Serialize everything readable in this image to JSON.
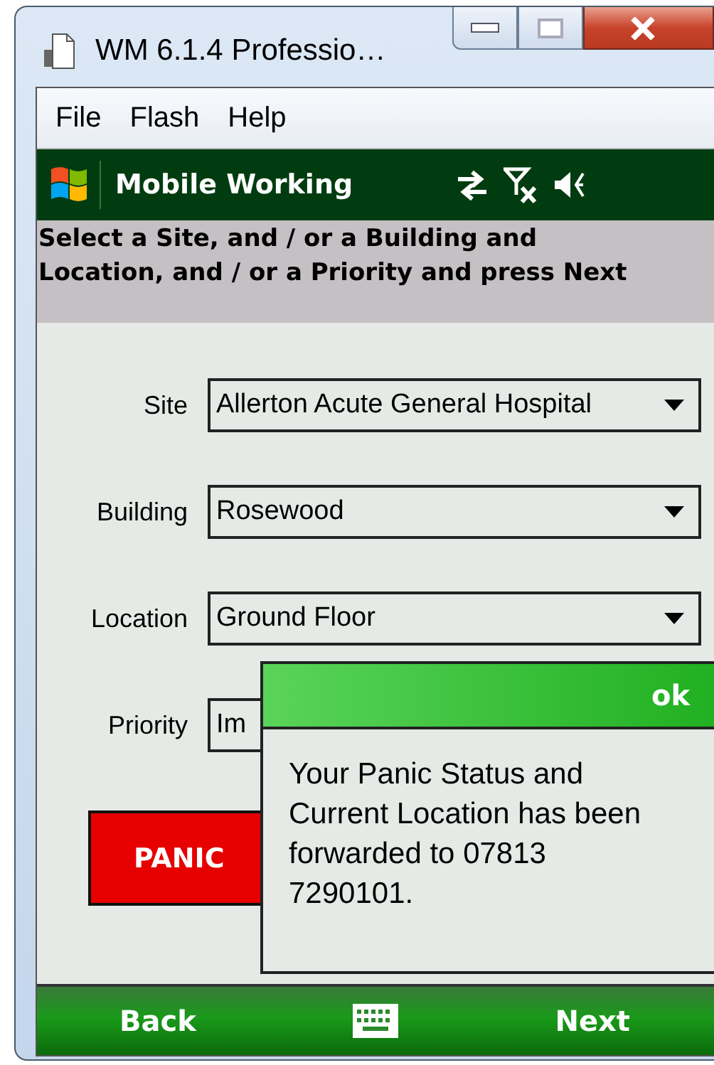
{
  "window": {
    "title": "WM 6.1.4 Professio…"
  },
  "menu": [
    "File",
    "Flash",
    "Help"
  ],
  "header": {
    "title": "Mobile Working"
  },
  "instruction": "Select a Site, and / or a Building and Location, and / or a Priority and press Next",
  "fields": [
    {
      "label": "Site",
      "value": "Allerton Acute General Hospital"
    },
    {
      "label": "Building",
      "value": "Rosewood"
    },
    {
      "label": "Location",
      "value": "Ground Floor"
    },
    {
      "label": "Priority",
      "value": "Im"
    }
  ],
  "panic_button": "PANIC",
  "dialog": {
    "button": "ok",
    "message": "Your Panic Status and Current Location has been forwarded to 07813 7290101."
  },
  "softkeys": {
    "left": "Back",
    "right": "Next"
  }
}
